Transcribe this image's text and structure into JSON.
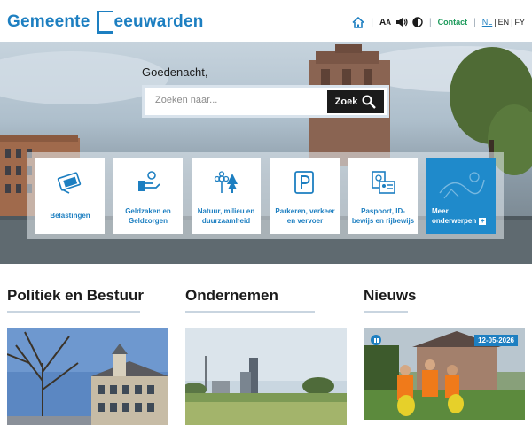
{
  "header": {
    "logo_pre": "Gemeente ",
    "logo_post": "eeuwarden",
    "contact": "Contact",
    "langs": [
      "NL",
      "EN",
      "FY"
    ]
  },
  "hero": {
    "greeting": "Goedenacht,",
    "search_placeholder": "Zoeken naar...",
    "search_button": "Zoek"
  },
  "tiles": [
    {
      "label": "Belastingen",
      "icon": "tax-money-icon"
    },
    {
      "label": "Geldzaken en Geldzorgen",
      "icon": "money-hands-icon"
    },
    {
      "label": "Natuur, milieu en duurzaamheid",
      "icon": "flower-tree-icon"
    },
    {
      "label": "Parkeren, verkeer en vervoer",
      "icon": "parking-icon"
    },
    {
      "label": "Paspoort, ID-bewijs en rijbewijs",
      "icon": "passport-id-icon"
    }
  ],
  "more_tile": {
    "line1": "Meer",
    "line2": "onderwerpen",
    "plus": "+"
  },
  "sections": [
    {
      "title": "Politiek en Bestuur"
    },
    {
      "title": "Ondernemen"
    },
    {
      "title": "Nieuws"
    }
  ],
  "news": {
    "date": "12-05-2026"
  },
  "colors": {
    "brand_blue": "#1d7fc1",
    "contact_green": "#1d9a5b",
    "tile_more": "#1f8acb"
  }
}
